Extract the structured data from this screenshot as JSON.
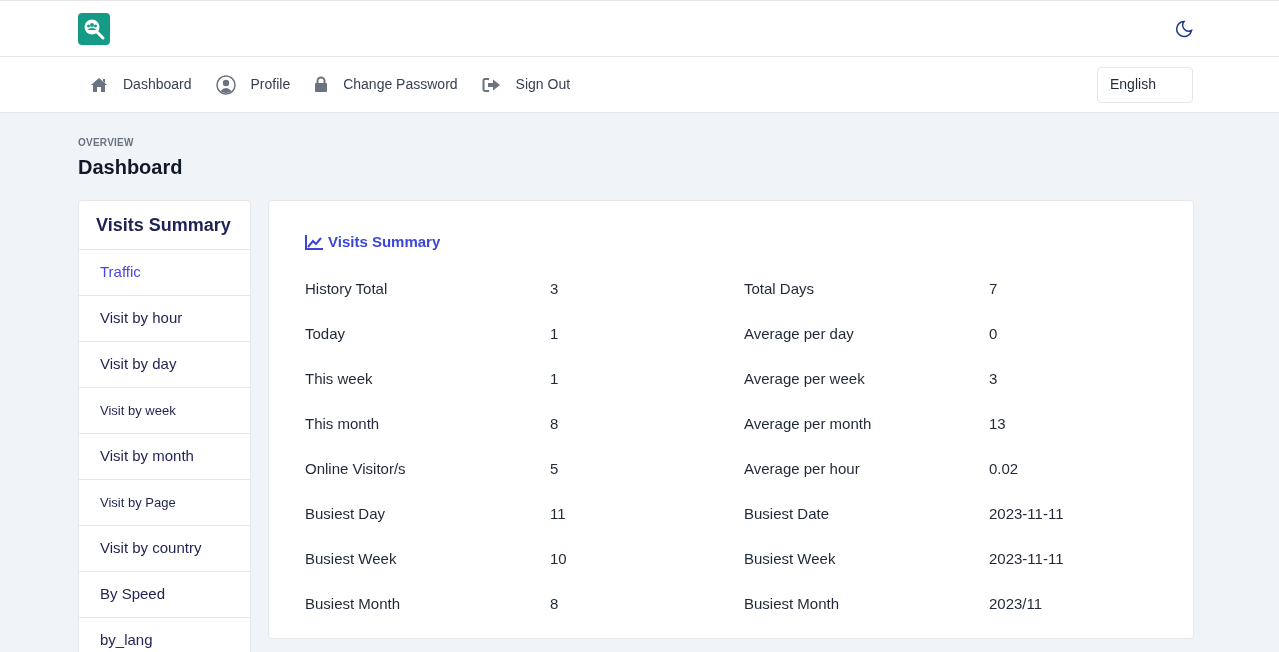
{
  "nav": [
    {
      "label": "Dashboard",
      "kind": "home"
    },
    {
      "label": "Profile",
      "kind": "user"
    },
    {
      "label": "Change Password",
      "kind": "lock"
    },
    {
      "label": "Sign Out",
      "kind": "signout"
    }
  ],
  "language": "English",
  "page": {
    "eyebrow": "OVERVIEW",
    "title": "Dashboard"
  },
  "sidebar": {
    "title": "Visits Summary",
    "items": [
      {
        "label": "Traffic",
        "selected": true,
        "kind": "normal"
      },
      {
        "label": "Visit by hour",
        "selected": false,
        "kind": "normal"
      },
      {
        "label": "Visit by day",
        "selected": false,
        "kind": "normal"
      },
      {
        "label": "Visit by week",
        "selected": false,
        "kind": "small"
      },
      {
        "label": "Visit by month",
        "selected": false,
        "kind": "normal"
      },
      {
        "label": "Visit by Page",
        "selected": false,
        "kind": "small"
      },
      {
        "label": "Visit by country",
        "selected": false,
        "kind": "normal"
      },
      {
        "label": "By Speed",
        "selected": false,
        "kind": "normal"
      },
      {
        "label": "by_lang",
        "selected": false,
        "kind": "normal"
      }
    ]
  },
  "summary": {
    "title": "Visits Summary",
    "rows": [
      {
        "label": "History Total",
        "value": "3",
        "label_2": "Total Days",
        "value_2": "7"
      },
      {
        "label": "Today",
        "value": "1",
        "label_2": "Average per day",
        "value_2": "0"
      },
      {
        "label": "This week",
        "value": "1",
        "label_2": "Average per week",
        "value_2": "3"
      },
      {
        "label": "This month",
        "value": "8",
        "label_2": "Average per month",
        "value_2": "13"
      },
      {
        "label": "Online Visitor/s",
        "value": "5",
        "label_2": "Average per hour",
        "value_2": "0.02"
      },
      {
        "label": "Busiest Day",
        "value": "11",
        "label_2": "Busiest Date",
        "value_2": "2023-11-11"
      },
      {
        "label": "Busiest Week",
        "value": "10",
        "label_2": "Busiest Week",
        "value_2": "2023-11-11"
      },
      {
        "label": "Busiest Month",
        "value": "8",
        "label_2": "Busiest Month",
        "value_2": "2023/11"
      }
    ]
  }
}
